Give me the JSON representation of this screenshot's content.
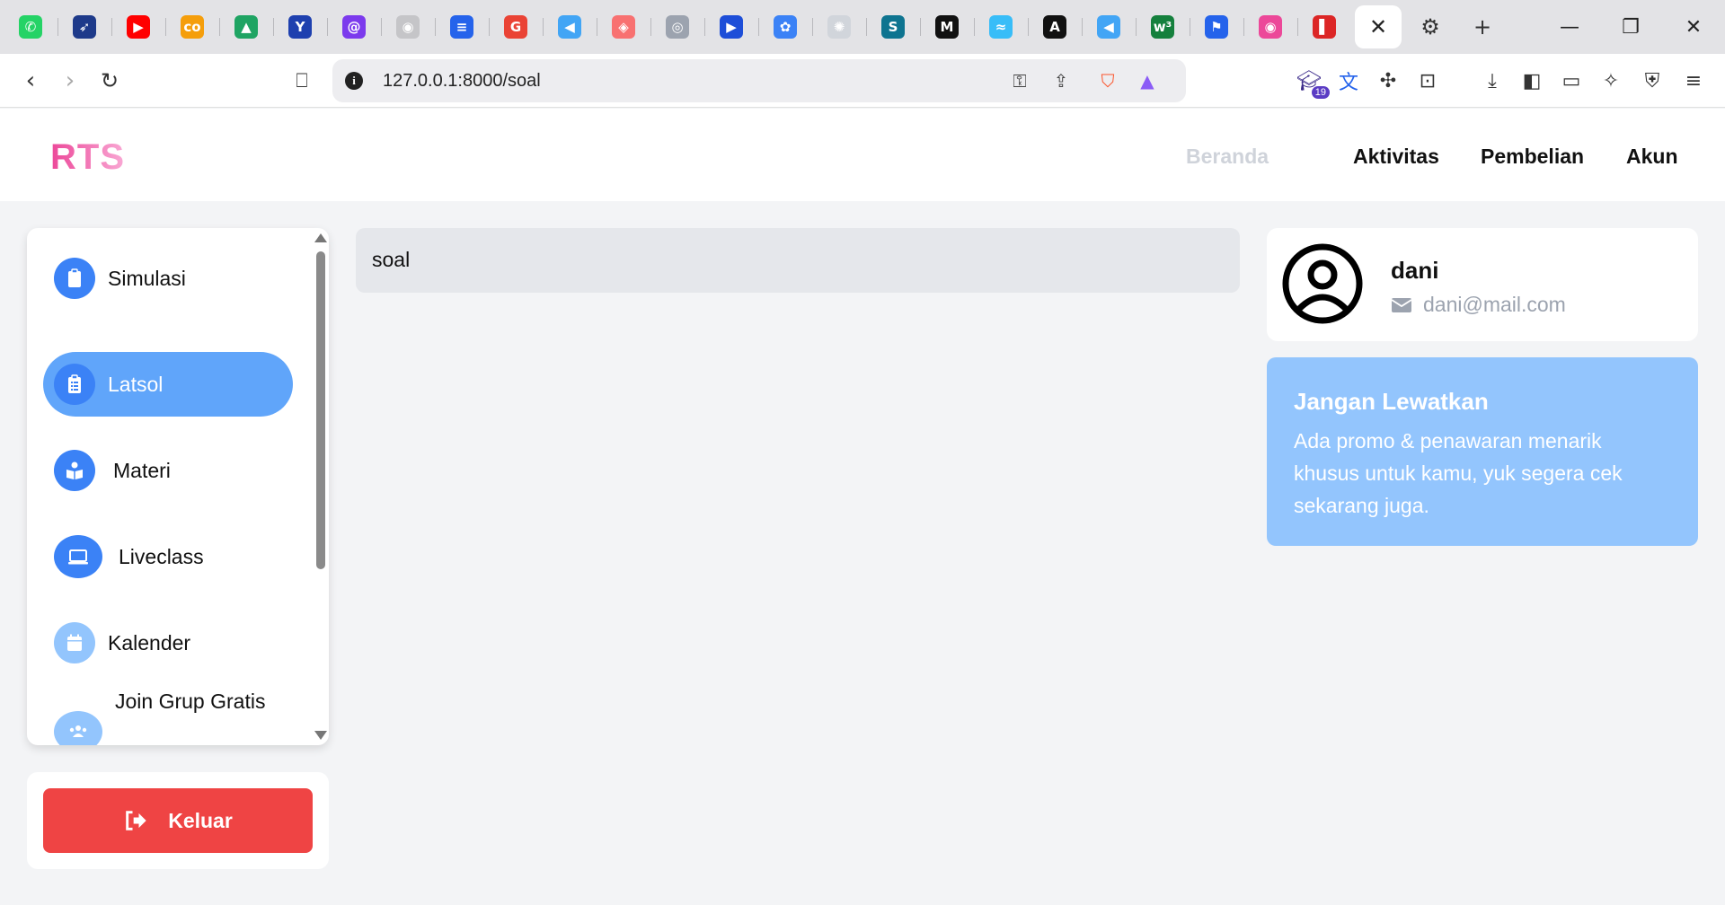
{
  "browser": {
    "tabs": [
      {
        "icon": "whatsapp-icon",
        "glyph": "✆",
        "color": "#25d366"
      },
      {
        "icon": "bird-icon",
        "glyph": "➶",
        "color": "#1e3a8a"
      },
      {
        "icon": "youtube-icon",
        "glyph": "▶",
        "color": "#ff0000"
      },
      {
        "icon": "coursera-icon",
        "glyph": "co",
        "color": "#f59e0b"
      },
      {
        "icon": "google-drive-icon",
        "glyph": "▲",
        "color": "#1fa463"
      },
      {
        "icon": "flutter-devtools-icon",
        "glyph": "Y",
        "color": "#1e40af"
      },
      {
        "icon": "purple-swirl-icon",
        "glyph": "@",
        "color": "#7c3aed"
      },
      {
        "icon": "github-icon",
        "glyph": "◉",
        "color": "#c5c5c8"
      },
      {
        "icon": "google-forms-icon",
        "glyph": "≡",
        "color": "#2563eb"
      },
      {
        "icon": "google-icon",
        "glyph": "G",
        "color": "#ea4335"
      },
      {
        "icon": "flutter-icon",
        "glyph": "◀",
        "color": "#42a5f5"
      },
      {
        "icon": "laravel-icon",
        "glyph": "◈",
        "color": "#f87171"
      },
      {
        "icon": "chrome-grey-icon",
        "glyph": "◎",
        "color": "#9ca3af"
      },
      {
        "icon": "play-icon",
        "glyph": "▶",
        "color": "#1d4ed8"
      },
      {
        "icon": "docker-icon",
        "glyph": "✿",
        "color": "#3b82f6"
      },
      {
        "icon": "openai-icon",
        "glyph": "✺",
        "color": "#d1d5db"
      },
      {
        "icon": "scribd-icon",
        "glyph": "S",
        "color": "#0e7490"
      },
      {
        "icon": "medium-icon",
        "glyph": "M",
        "color": "#111111"
      },
      {
        "icon": "tailwind-icon",
        "glyph": "≈",
        "color": "#38bdf8"
      },
      {
        "icon": "angular-icon",
        "glyph": "A",
        "color": "#111111"
      },
      {
        "icon": "flutter-icon",
        "glyph": "◀",
        "color": "#42a5f5"
      },
      {
        "icon": "w3schools-icon",
        "glyph": "w³",
        "color": "#15803d"
      },
      {
        "icon": "flag-icon",
        "glyph": "⚑",
        "color": "#2563eb"
      },
      {
        "icon": "pink-circle-icon",
        "glyph": "◉",
        "color": "#ec4899"
      },
      {
        "icon": "red-logo-icon",
        "glyph": "▌",
        "color": "#dc2626"
      }
    ],
    "active_tab_close": "✕",
    "new_tab": "+",
    "url": "127.0.0.1:8000/soal",
    "extension_badge": "19"
  },
  "header": {
    "logo": "RTS",
    "nav": [
      "Beranda",
      "Aktivitas",
      "Pembelian",
      "Akun"
    ]
  },
  "sidebar": {
    "items": [
      {
        "label": "Simulasi",
        "icon": "clipboard-icon",
        "color": "#3b82f6",
        "active": false
      },
      {
        "label": "Latsol",
        "icon": "clipboard-list-icon",
        "color": "#3b82f6",
        "active": true
      },
      {
        "label": "Materi",
        "icon": "book-reader-icon",
        "color": "#3b82f6",
        "active": false
      },
      {
        "label": "Liveclass",
        "icon": "laptop-icon",
        "color": "#3b82f6",
        "active": false
      },
      {
        "label": "Kalender",
        "icon": "calendar-icon",
        "color": "#93c5fd",
        "active": false
      },
      {
        "label": "Join Grup Gratis",
        "icon": "users-icon",
        "color": "#93c5fd",
        "active": false
      }
    ]
  },
  "logout": {
    "label": "Keluar",
    "icon": "sign-out-icon",
    "color": "#ef4444"
  },
  "main": {
    "breadcrumb": "soal"
  },
  "profile": {
    "name": "dani",
    "email": "dani@mail.com"
  },
  "promo": {
    "title": "Jangan Lewatkan",
    "text": "Ada promo & penawaran menarik khusus untuk kamu, yuk segera cek sekarang juga."
  }
}
